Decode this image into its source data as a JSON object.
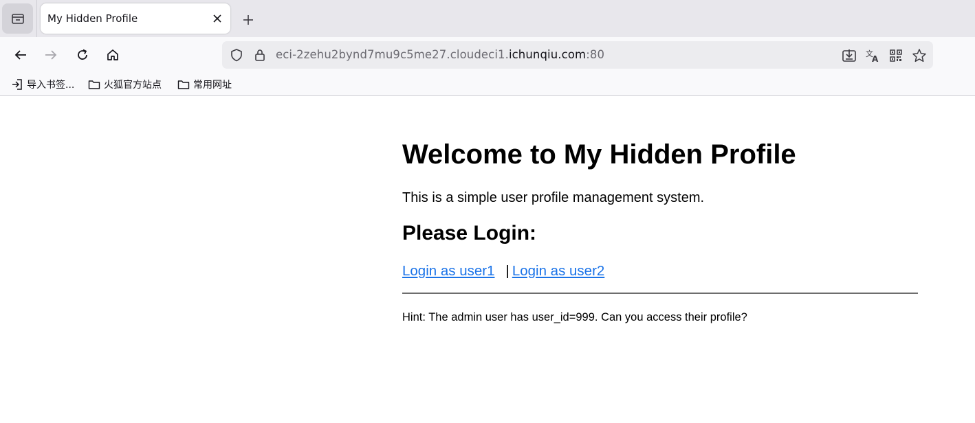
{
  "browser": {
    "tab": {
      "title": "My Hidden Profile"
    },
    "url": {
      "prefix": "eci-2zehu2bynd7mu9c5me27.cloudeci1.",
      "domain": "ichunqiu.com",
      "suffix": ":80"
    },
    "bookmarks": [
      {
        "label": "导入书签...",
        "icon": "import-icon"
      },
      {
        "label": "火狐官方站点",
        "icon": "folder-icon"
      },
      {
        "label": "常用网址",
        "icon": "folder-icon"
      }
    ]
  },
  "page": {
    "title": "Welcome to My Hidden Profile",
    "intro": "This is a simple user profile management system.",
    "login_heading": "Please Login:",
    "links": {
      "user1": "Login as user1",
      "separator": "|",
      "user2": "Login as user2"
    },
    "hint": "Hint: The admin user has user_id=999. Can you access their profile?"
  },
  "colors": {
    "link": "#1a73e8",
    "tabstrip": "#e8e7ec",
    "toolbar": "#f9f9fb"
  }
}
